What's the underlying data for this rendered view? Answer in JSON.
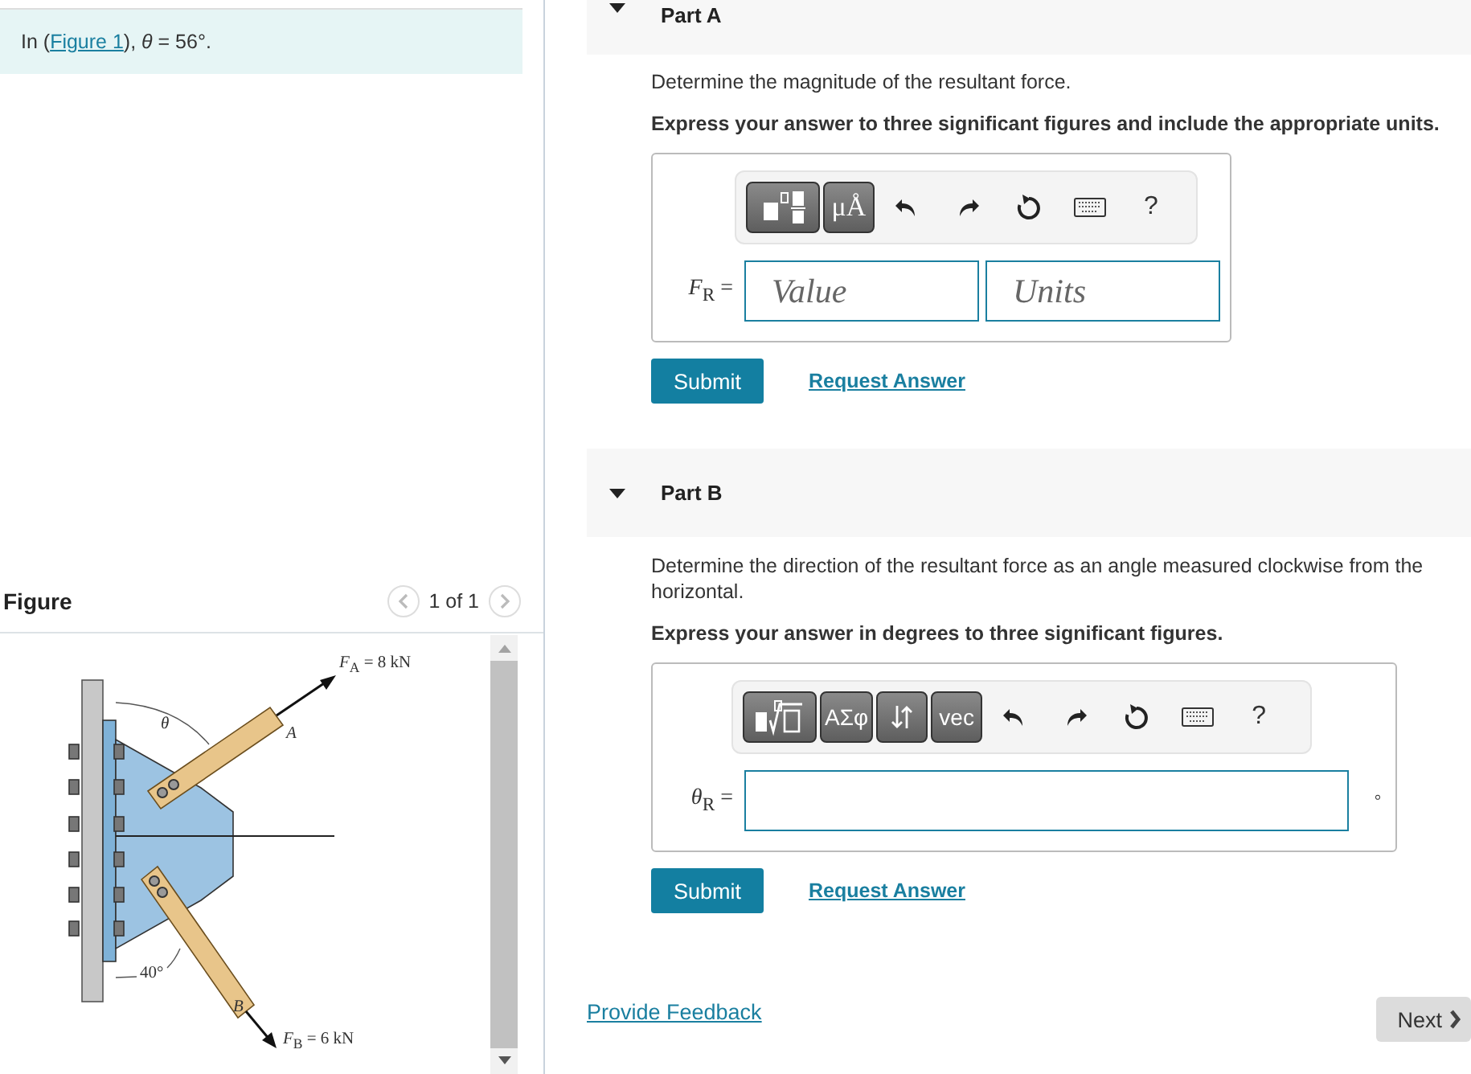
{
  "problem": {
    "prefix": "In (",
    "link": "Figure 1",
    "suffix": "), *θ* = 56°."
  },
  "figure": {
    "title": "Figure",
    "pager": "1 of 1",
    "labels": [
      {
        "kind": "force-a",
        "text": "*F*$_{A}$ = 8 kN"
      },
      {
        "kind": "theta",
        "text": "*θ*"
      },
      {
        "kind": "point-a",
        "text": "*A*"
      },
      {
        "kind": "angle-b",
        "text": "40°"
      },
      {
        "kind": "point-b",
        "text": "*B*"
      },
      {
        "kind": "force-b",
        "text": "*F*$_{B}$ = 6 kN"
      }
    ]
  },
  "parts": [
    {
      "title": "Part A",
      "expanded": true,
      "question": "Determine the magnitude of the resultant force.",
      "instruction": "Express your answer to three significant figures and include the appropriate units.",
      "tools": [
        {
          "kind": "templates"
        },
        {
          "kind": "label",
          "text": "μÅ"
        },
        {
          "kind": "undo"
        },
        {
          "kind": "redo"
        },
        {
          "kind": "reset"
        },
        {
          "kind": "keyboard"
        },
        {
          "kind": "help",
          "text": "?"
        }
      ],
      "answer": {
        "label": "*F*$_{R}$ =",
        "fields": [
          {
            "kind": "value",
            "placeholder": "Value"
          },
          {
            "kind": "units",
            "placeholder": "Units"
          }
        ]
      },
      "submit": "Submit",
      "request": "Request Answer"
    },
    {
      "title": "Part B",
      "expanded": true,
      "question": "Determine the direction of the resultant force as an angle measured clockwise from the horizontal.",
      "instruction": "Express your answer in degrees to three significant figures.",
      "tools": [
        {
          "kind": "templates-root"
        },
        {
          "kind": "label",
          "text": "ΑΣφ"
        },
        {
          "kind": "arrows"
        },
        {
          "kind": "label",
          "text": "vec"
        },
        {
          "kind": "undo"
        },
        {
          "kind": "redo"
        },
        {
          "kind": "reset"
        },
        {
          "kind": "keyboard"
        },
        {
          "kind": "help",
          "text": "?"
        }
      ],
      "answer": {
        "label": "*θ*$_{R}$ =",
        "fields": [
          {
            "kind": "wide"
          }
        ],
        "unit": "°"
      },
      "submit": "Submit",
      "request": "Request Answer"
    }
  ],
  "footer": {
    "feedback": "Provide Feedback",
    "next": "Next"
  }
}
